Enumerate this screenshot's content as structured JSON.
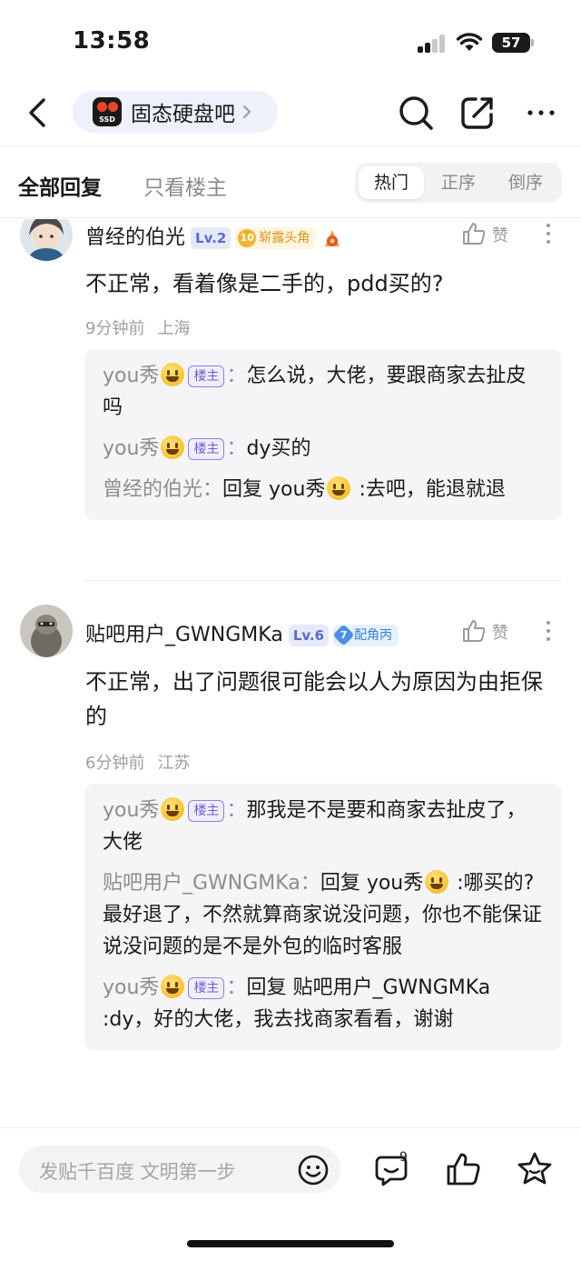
{
  "status": {
    "time": "13:58",
    "battery": "57"
  },
  "nav": {
    "forum_name": "固态硬盘吧",
    "forum_logo_text": "SSD"
  },
  "tabs": {
    "all": "全部回复",
    "op_only": "只看楼主",
    "sort": [
      "热门",
      "正序",
      "倒序"
    ],
    "active_sort": "热门"
  },
  "comments": [
    {
      "user": "曾经的伯光",
      "level": "Lv.2",
      "badge_num": "10",
      "badge_label": "崭露头角",
      "text": "不正常，看着像是二手的，pdd买的?",
      "time": "9分钟前",
      "location": "上海",
      "like_label": "赞",
      "replies": [
        {
          "name": "you秀",
          "emoji": true,
          "op_tag": "楼主",
          "sep": "：",
          "text": "怎么说，大佬，要跟商家去扯皮吗"
        },
        {
          "name": "you秀",
          "emoji": true,
          "op_tag": "楼主",
          "sep": "：",
          "text": "dy买的"
        },
        {
          "name": "曾经的伯光",
          "sep": "：",
          "text_pre": "回复 you秀",
          "text_emoji": true,
          "text": " :去吧，能退就退"
        }
      ]
    },
    {
      "user": "贴吧用户_GWNGMKa",
      "level": "Lv.6",
      "badge_num": "7",
      "badge_label": "配角丙",
      "text": "不正常，出了问题很可能会以人为原因为由拒保的",
      "time": "6分钟前",
      "location": "江苏",
      "like_label": "赞",
      "replies": [
        {
          "name": "you秀",
          "emoji": true,
          "op_tag": "楼主",
          "sep": "：",
          "text": "那我是不是要和商家去扯皮了，大佬"
        },
        {
          "name": "贴吧用户_GWNGMKa",
          "sep": "：",
          "text_pre": "回复 you秀",
          "text_emoji": true,
          "text": " :哪买的? 最好退了，不然就算商家说没问题，你也不能保证说没问题的是不是外包的临时客服"
        },
        {
          "name": "you秀",
          "emoji": true,
          "op_tag": "楼主",
          "sep": "：",
          "text": "回复 贴吧用户_GWNGMKa :dy，好的大佬，我去找商家看看，谢谢"
        }
      ]
    }
  ],
  "bottom": {
    "placeholder": "发贴千百度 文明第一步",
    "comment_count": "9"
  }
}
